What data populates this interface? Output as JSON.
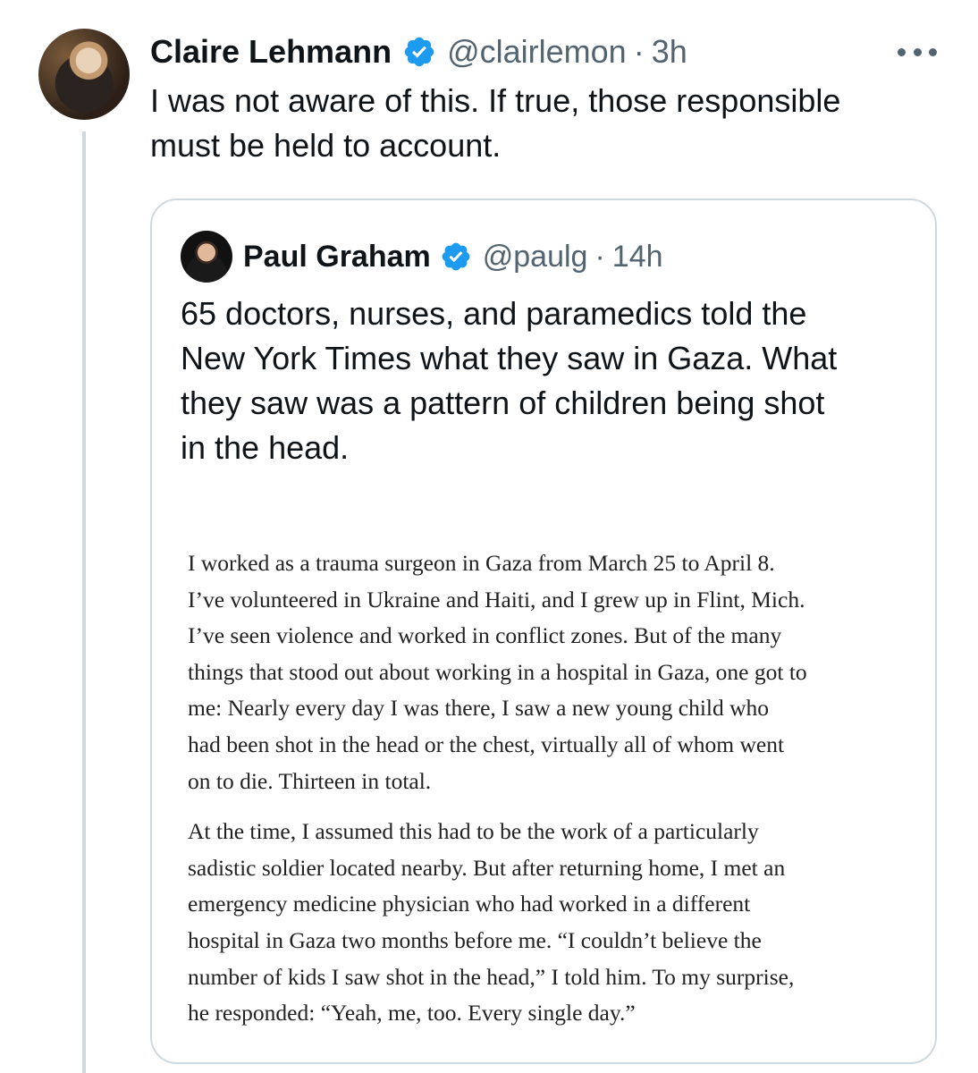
{
  "tweet": {
    "author": {
      "name": "Claire Lehmann",
      "handle": "@clairlemon",
      "separator": "·",
      "time": "3h",
      "verified": true
    },
    "text_lines": [
      "I was not aware of this. If true, those responsible",
      "must be held to account."
    ],
    "more_icon": "more-horizontal-icon"
  },
  "quote": {
    "author": {
      "name": "Paul Graham",
      "handle": "@paulg",
      "separator": "·",
      "time": "14h",
      "verified": true
    },
    "text_lines": [
      "65 doctors, nurses, and paramedics told the",
      "New York Times what they saw in Gaza. What",
      "they saw was a pattern of children being shot",
      "in the head."
    ],
    "article": {
      "paragraph1": [
        "I worked as a trauma surgeon in Gaza from March 25 to April 8.",
        "I’ve volunteered in Ukraine and Haiti, and I grew up in Flint, Mich.",
        "I’ve seen violence and worked in conflict zones. But of the many",
        "things that stood out about working in a hospital in Gaza, one got to",
        "me: Nearly every day I was there, I saw a new young child who",
        "had been shot in the head or the chest, virtually all of whom went",
        "on to die. Thirteen in total."
      ],
      "paragraph2": [
        "At the time, I assumed this had to be the work of a particularly",
        "sadistic soldier located nearby. But after returning home, I met an",
        "emergency medicine physician who had worked in a different",
        "hospital in Gaza two months before me. “I couldn’t believe the",
        "number of kids I saw shot in the head,” I told him. To my surprise,",
        "he responded: “Yeah, me, too. Every single day.”"
      ]
    }
  },
  "colors": {
    "text_primary": "#0f1419",
    "text_secondary": "#536471",
    "verified_blue": "#1d9bf0",
    "border": "#cfd9de",
    "article_text": "#222222"
  }
}
